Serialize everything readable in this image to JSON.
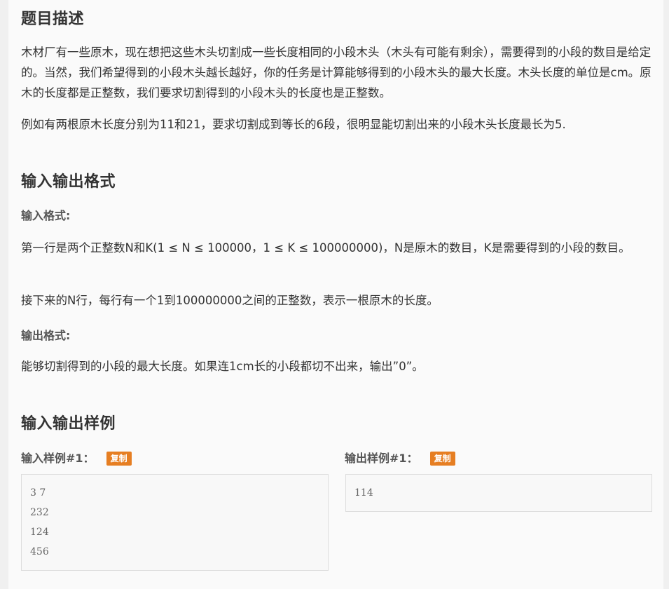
{
  "sections": {
    "description": {
      "title": "题目描述",
      "paragraphs": [
        "木材厂有一些原木，现在想把这些木头切割成一些长度相同的小段木头（木头有可能有剩余），需要得到的小段的数目是给定的。当然，我们希望得到的小段木头越长越好，你的任务是计算能够得到的小段木头的最大长度。木头长度的单位是cm。原木的长度都是正整数，我们要求切割得到的小段木头的长度也是正整数。",
        "例如有两根原木长度分别为11和21，要求切割成到等长的6段，很明显能切割出来的小段木头长度最长为5."
      ]
    },
    "io_format": {
      "title": "输入输出格式",
      "input_label": "输入格式:",
      "input_paragraphs": [
        "第一行是两个正整数N和K(1 ≤ N ≤ 100000，1 ≤ K ≤ 100000000)，N是原木的数目，K是需要得到的小段的数目。",
        "接下来的N行，每行有一个1到100000000之间的正整数，表示一根原木的长度。"
      ],
      "output_label": "输出格式:",
      "output_paragraphs": [
        "能够切割得到的小段的最大长度。如果连1cm长的小段都切不出来，输出”0”。"
      ]
    },
    "samples": {
      "title": "输入输出样例",
      "input_label": "输入样例#1：",
      "output_label": "输出样例#1：",
      "copy_label": "复制",
      "input_lines": [
        "3 7",
        "232",
        "124",
        "456"
      ],
      "output_lines": [
        "114"
      ]
    }
  },
  "colors": {
    "page_bg": "#f0f0f0",
    "card_bg": "#fafafa",
    "badge": "#e67e22",
    "text": "#333333"
  }
}
